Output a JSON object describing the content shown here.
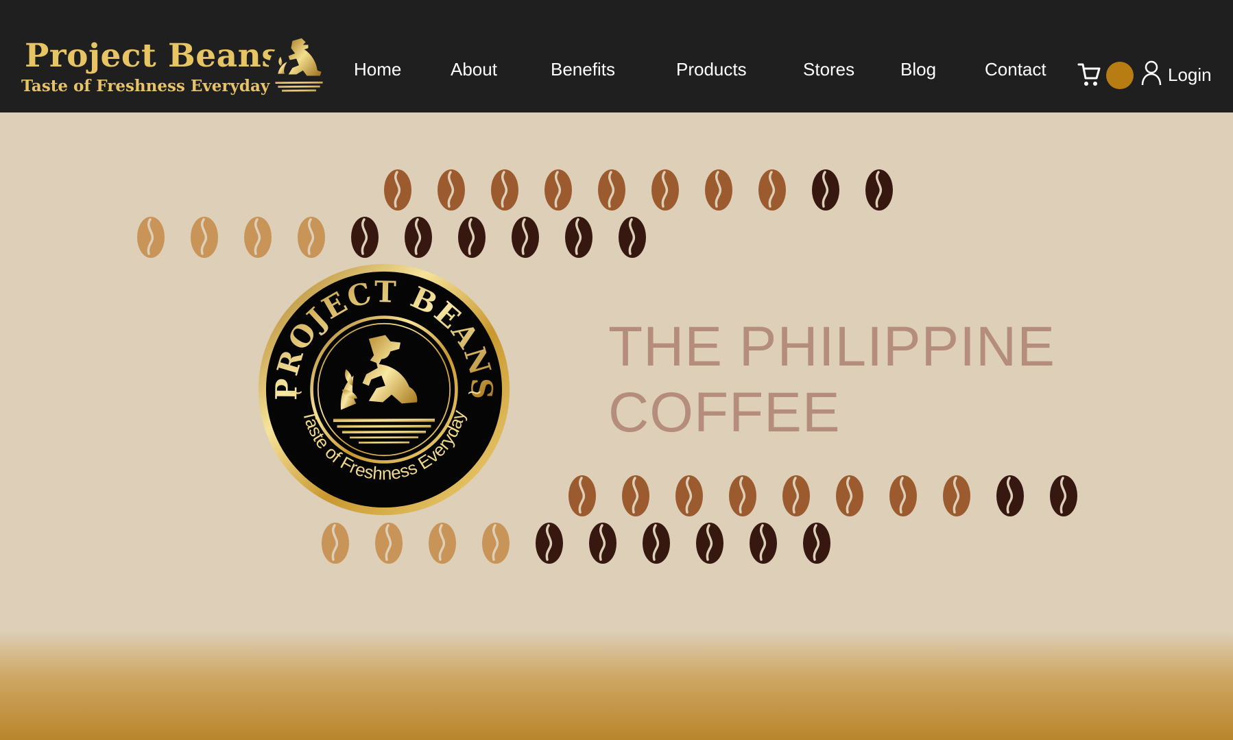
{
  "header": {
    "brand": {
      "name": "Project Beans",
      "tagline": "Taste of Freshness Everyday",
      "logo_icon": "farmer-emblem-icon"
    },
    "nav": [
      {
        "label": "Home"
      },
      {
        "label": "About"
      },
      {
        "label": "Benefits"
      },
      {
        "label": "Products"
      },
      {
        "label": "Stores"
      },
      {
        "label": "Blog"
      },
      {
        "label": "Contact"
      }
    ],
    "cart_icon": "cart-icon",
    "theme_toggle_icon": "theme-toggle-icon",
    "login": {
      "label": "Login",
      "icon": "user-icon"
    }
  },
  "hero": {
    "title_line1": "THE PHILIPPINE",
    "title_line2": "COFFEE",
    "seal": {
      "top_text": "PROJECT BEANS",
      "bottom_text": "Taste of Freshness Everyday"
    }
  },
  "colors": {
    "nav_background": "#201f20",
    "page_background": "#ddcfb8",
    "gold": "#e8c564",
    "accent_orange": "#b77d12",
    "title_color": "#b58d7c",
    "bean_light": "#c89458",
    "bean_medium": "#9b5b2e",
    "bean_dark": "#361810",
    "footer_gold": "#b8852b"
  }
}
